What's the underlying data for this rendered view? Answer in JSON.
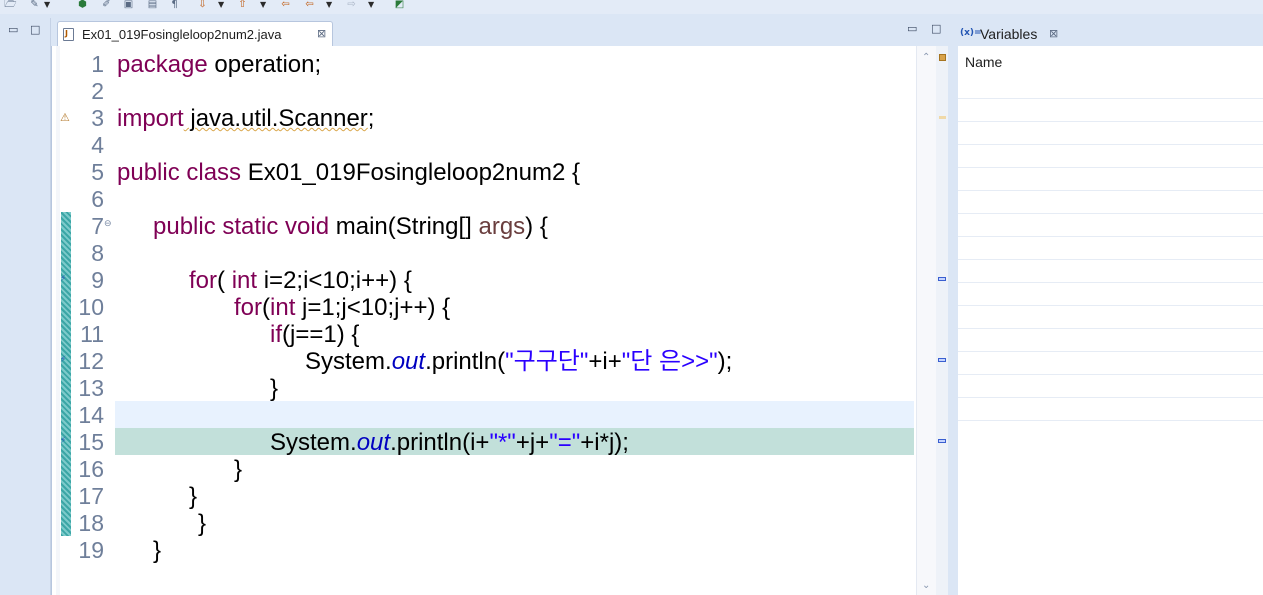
{
  "toolbar": {
    "icons": [
      "open-perspective-icon",
      "external-tools-icon",
      "debug-icon",
      "edit-icon",
      "save-all-icon",
      "save-icon",
      "show-whitespace-icon",
      "next-annotation-icon",
      "previous-annotation-icon",
      "back-icon",
      "forward-icon",
      "new-window-icon"
    ]
  },
  "editor": {
    "tab_label": "Ex01_019Fosingleloop2num2.java",
    "tab_close": "⊠",
    "minimize": "▭",
    "maximize": "□",
    "line_numbers": [
      "1",
      "2",
      "3",
      "4",
      "5",
      "6",
      "7",
      "8",
      "9",
      "10",
      "11",
      "12",
      "13",
      "14",
      "15",
      "16",
      "17",
      "18",
      "19"
    ],
    "code": {
      "l1_kw": "package",
      "l1_rest": " operation;",
      "l3_kw": "import",
      "l3_pkg": " java.util.",
      "l3_cls": "Scanner",
      "l3_end": ";",
      "l5_kw": "public class",
      "l5_rest": " Ex01_019Fosingleloop2num2 {",
      "l7_kw": "public static void",
      "l7_mid": " main(String[] ",
      "l7_prm": "args",
      "l7_end": ") {",
      "l9_kw": "for",
      "l9_a": "( ",
      "l9_kw2": "int",
      "l9_rest": " i=2;i<10;i++) {",
      "l10_kw": "for",
      "l10_a": "(",
      "l10_kw2": "int",
      "l10_rest": " j=1;j<10;j++) {",
      "l11_kw": "if",
      "l11_rest": "(j==1) {",
      "l12_a": "System.",
      "l12_fld": "out",
      "l12_b": ".println(",
      "l12_s1": "\"구구단\"",
      "l12_c": "+i+",
      "l12_s2": "\"단 은>>\"",
      "l12_d": ");",
      "l13": "}",
      "l15_a": "System.",
      "l15_fld": "out",
      "l15_b": ".println(i+",
      "l15_s1": "\"*\"",
      "l15_c": "+j+",
      "l15_s2": "\"=\"",
      "l15_d": "+i*j);",
      "l16": "}",
      "l17": "}",
      "l18": "}",
      "l19": "}"
    }
  },
  "variables": {
    "tab_icon": "(x)=",
    "tab_label": "Variables",
    "tab_close": "⊠",
    "column_name": "Name"
  }
}
